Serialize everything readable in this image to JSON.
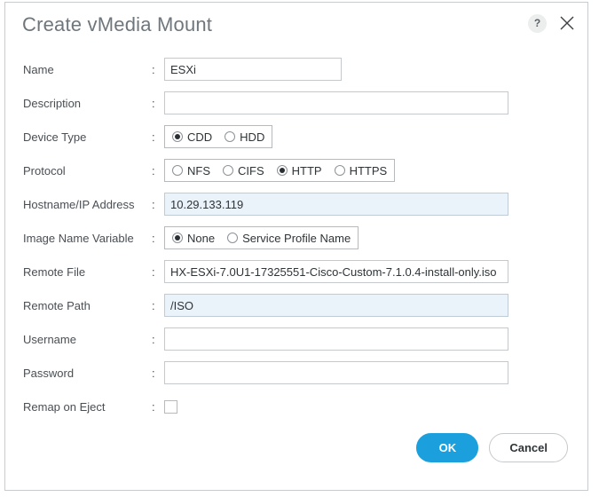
{
  "dialog": {
    "title": "Create vMedia Mount",
    "help_label": "?",
    "close_label": "close-icon"
  },
  "form": {
    "colon": ":",
    "rows": [
      {
        "label": "Name",
        "type": "text",
        "value": "ESXi",
        "placeholder": "",
        "tinted": false,
        "width": "narrow"
      },
      {
        "label": "Description",
        "type": "text",
        "value": "",
        "placeholder": "",
        "tinted": false,
        "width": "wide"
      },
      {
        "label": "Device Type",
        "type": "radio",
        "options": [
          "CDD",
          "HDD"
        ],
        "selected": "CDD"
      },
      {
        "label": "Protocol",
        "type": "radio",
        "options": [
          "NFS",
          "CIFS",
          "HTTP",
          "HTTPS"
        ],
        "selected": "HTTP"
      },
      {
        "label": "Hostname/IP Address",
        "type": "text",
        "value": "10.29.133.119",
        "placeholder": "",
        "tinted": true,
        "width": "wide"
      },
      {
        "label": "Image Name Variable",
        "type": "radio",
        "options": [
          "None",
          "Service Profile Name"
        ],
        "selected": "None"
      },
      {
        "label": "Remote File",
        "type": "text",
        "value": "HX-ESXi-7.0U1-17325551-Cisco-Custom-7.1.0.4-install-only.iso",
        "placeholder": "",
        "tinted": false,
        "width": "wide"
      },
      {
        "label": "Remote Path",
        "type": "text",
        "value": "/ISO",
        "placeholder": "",
        "tinted": true,
        "width": "wide"
      },
      {
        "label": "Username",
        "type": "text",
        "value": "",
        "placeholder": "",
        "tinted": false,
        "width": "wide"
      },
      {
        "label": "Password",
        "type": "password",
        "value": "",
        "placeholder": "",
        "tinted": false,
        "width": "wide"
      },
      {
        "label": "Remap on Eject",
        "type": "checkbox",
        "checked": false
      }
    ]
  },
  "footer": {
    "ok_label": "OK",
    "cancel_label": "Cancel"
  },
  "colors": {
    "accent": "#1ba0dd",
    "title": "#6f767c",
    "tinted_field": "#eaf2fa",
    "border": "#c6c9cb"
  }
}
